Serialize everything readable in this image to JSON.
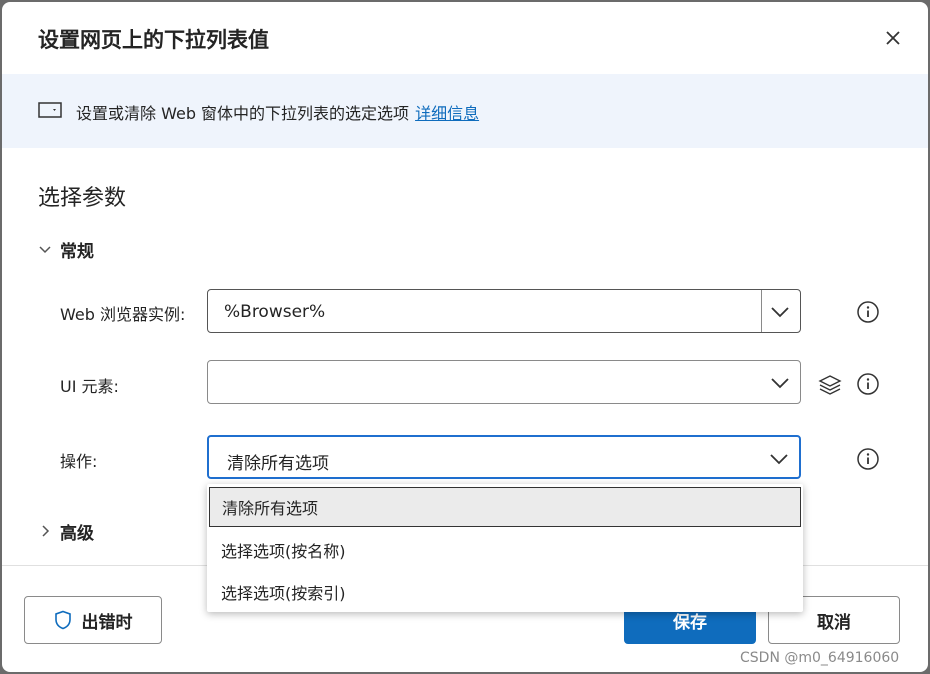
{
  "dialog": {
    "title": "设置网页上的下拉列表值",
    "description": "设置或清除 Web 窗体中的下拉列表的选定选项",
    "more_info_link": "详细信息"
  },
  "section": {
    "title": "选择参数"
  },
  "groups": {
    "general": "常规",
    "advanced": "高级"
  },
  "fields": {
    "browser_label": "Web 浏览器实例:",
    "browser_value": "%Browser%",
    "ui_element_label": "UI 元素:",
    "ui_element_value": "",
    "operation_label": "操作:",
    "operation_value": "清除所有选项"
  },
  "dropdown": {
    "options": [
      "清除所有选项",
      "选择选项(按名称)",
      "选择选项(按索引)"
    ],
    "selected_index": 0
  },
  "footer": {
    "on_error_label": "出错时",
    "save_label": "保存",
    "cancel_label": "取消"
  },
  "watermark": "CSDN @m0_64916060",
  "colors": {
    "accent": "#0f6cbd",
    "banner_bg": "#eff4fc",
    "focus_border": "#1f6fcf"
  }
}
